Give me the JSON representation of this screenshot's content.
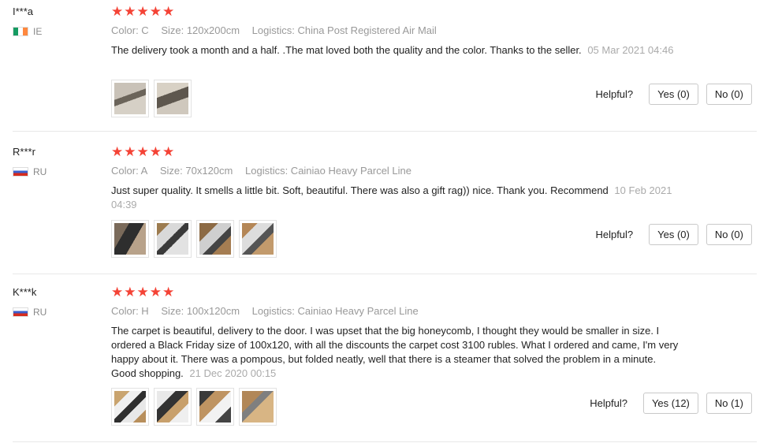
{
  "labels": {
    "helpful": "Helpful?"
  },
  "reviews": [
    {
      "user": "I***a",
      "country": "IE",
      "stars": "★★★★★",
      "color": "Color: C",
      "size": "Size: 120x200cm",
      "logistics": "Logistics: China Post Registered Air Mail",
      "text": "The delivery took a month and a half. .The mat loved both the quality and the color. Thanks to the seller.",
      "date": "05 Mar 2021 04:46",
      "yes": "Yes (0)",
      "no": "No (0)",
      "photo_count": 2
    },
    {
      "user": "R***r",
      "country": "RU",
      "stars": "★★★★★",
      "color": "Color: A",
      "size": "Size: 70x120cm",
      "logistics": "Logistics: Cainiao Heavy Parcel Line",
      "text": "Just super quality. It smells a little bit. Soft, beautiful. There was also a gift rag)) nice. Thank you. Recommend",
      "date": "10 Feb 2021 04:39",
      "yes": "Yes (0)",
      "no": "No (0)",
      "photo_count": 4
    },
    {
      "user": "K***k",
      "country": "RU",
      "stars": "★★★★★",
      "color": "Color: H",
      "size": "Size: 100x120cm",
      "logistics": "Logistics: Cainiao Heavy Parcel Line",
      "text": "The carpet is beautiful, delivery to the door. I was upset that the big honeycomb, I thought they would be smaller in size. I ordered a Black Friday size of 100x120, with all the discounts the carpet cost 3100 rubles. What I ordered and came, I'm very happy about it. There was a pompous, but folded neatly, well that there is a steamer that solved the problem in a minute. Good shopping.",
      "date": "21 Dec 2020 00:15",
      "yes": "Yes (12)",
      "no": "No (1)",
      "photo_count": 4
    }
  ]
}
